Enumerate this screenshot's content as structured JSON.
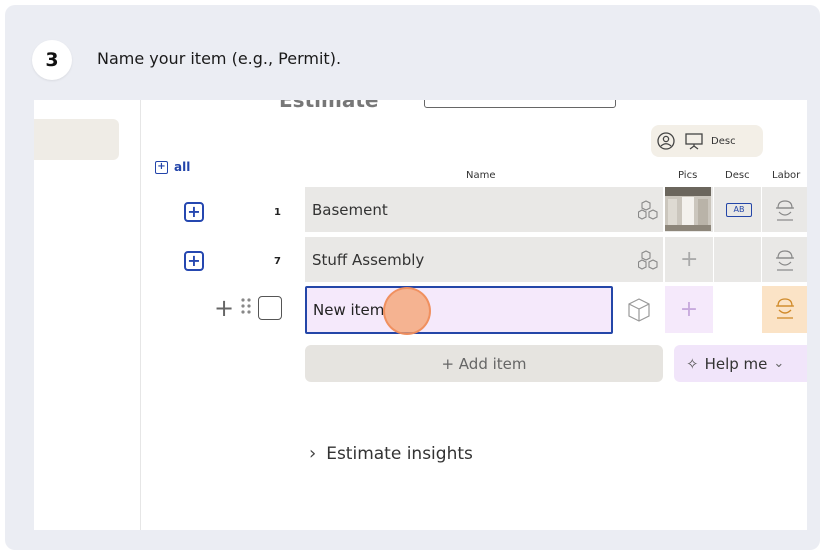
{
  "step": {
    "number": "3",
    "instruction": "Name your item (e.g., Permit)."
  },
  "topbar": {
    "title": "Estimate"
  },
  "panel_toggle": {
    "desc_label": "Desc"
  },
  "table": {
    "expand_all_label": "all",
    "columns": {
      "name": "Name",
      "pics": "Pics",
      "desc": "Desc",
      "labor": "Labor"
    },
    "rows": [
      {
        "number": "1",
        "name": "Basement",
        "desc_badge": "AB"
      },
      {
        "number": "7",
        "name": "Stuff Assembly"
      }
    ],
    "new_item": {
      "value": "New item"
    }
  },
  "actions": {
    "add_item": "+ Add item",
    "help_me": "Help me"
  },
  "insights": {
    "label": "Estimate insights"
  },
  "colors": {
    "accent": "#2446a8",
    "new_row_bg": "#f5e9fb",
    "click_marker": "#f4a06e",
    "labor_highlight": "#fbe3c6"
  }
}
